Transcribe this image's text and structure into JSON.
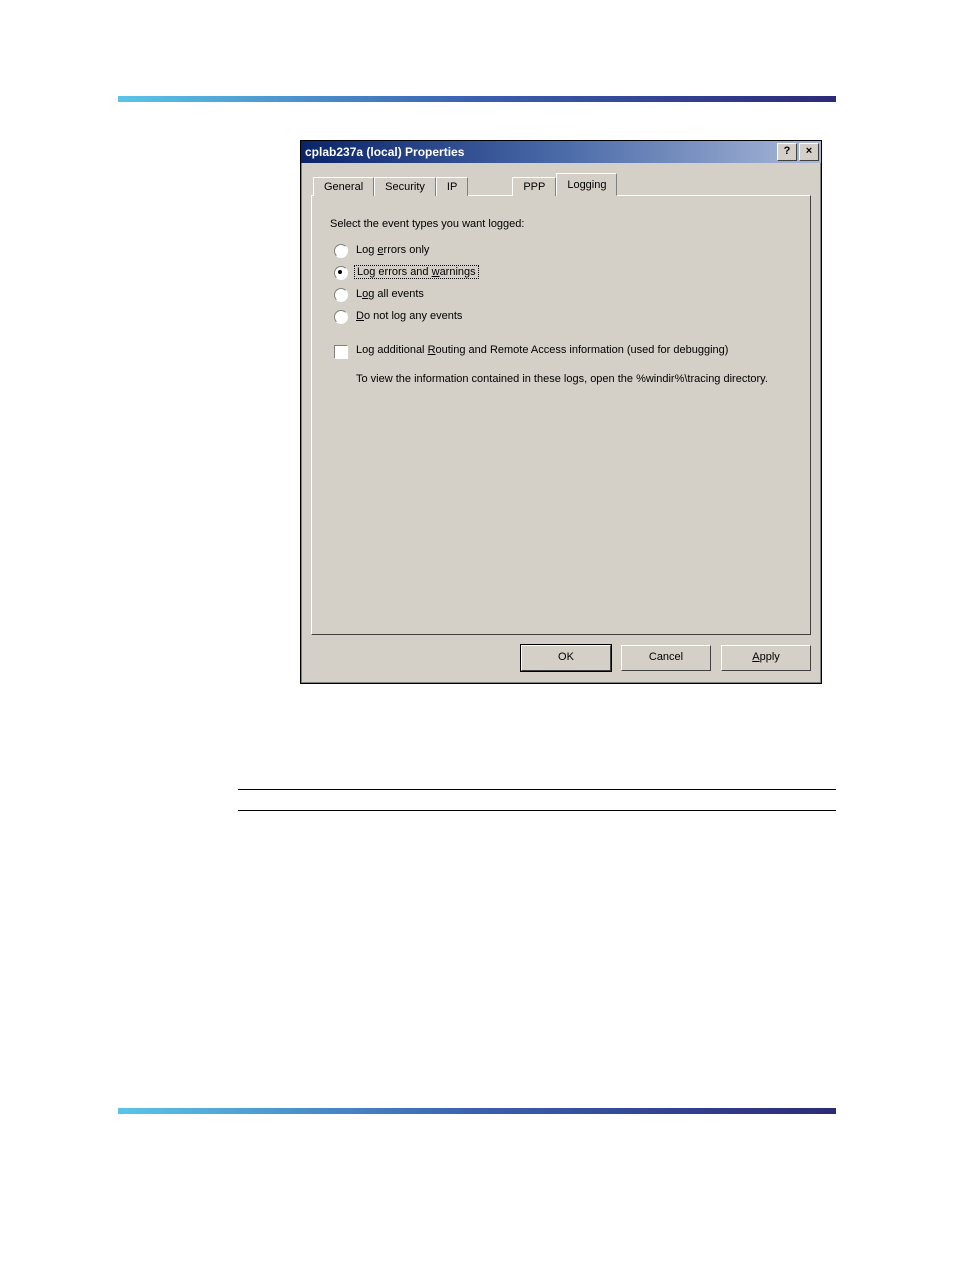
{
  "dialog": {
    "title": "cplab237a (local) Properties",
    "tabs": {
      "general": "General",
      "security": "Security",
      "ip": "IP",
      "ppp": "PPP",
      "logging": "Logging"
    },
    "instruction": "Select the event types you want logged:",
    "radios": {
      "errors_only_pre": "Log ",
      "errors_only_u": "e",
      "errors_only_post": "rrors only",
      "errors_warnings_pre": "Log errors and ",
      "errors_warnings_u": "w",
      "errors_warnings_post": "arnings",
      "all_events_pre": "L",
      "all_events_u": "o",
      "all_events_post": "g all events",
      "no_events_u": "D",
      "no_events_post": "o not log any events"
    },
    "checkbox": {
      "pre": "Log additional ",
      "u": "R",
      "post": "outing and Remote Access information (used for debugging)"
    },
    "info": "To view the information contained in these logs, open the %windir%\\tracing directory.",
    "buttons": {
      "ok": "OK",
      "cancel": "Cancel",
      "apply_u": "A",
      "apply_post": "pply"
    },
    "titlebuttons": {
      "help": "?",
      "close": "×"
    }
  }
}
